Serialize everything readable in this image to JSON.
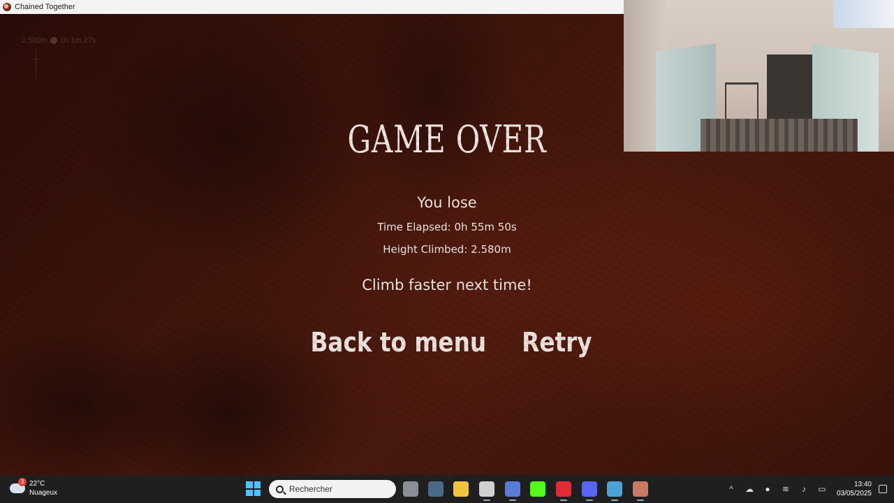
{
  "window": {
    "title": "Chained Together"
  },
  "hud": {
    "height": "2.580m",
    "time": "1h 1m 27s"
  },
  "game_over": {
    "title": "GAME OVER",
    "result": "You lose",
    "time_elapsed": "Time Elapsed: 0h 55m 50s",
    "height_climbed": "Height Climbed: 2.580m",
    "message": "Climb faster next time!",
    "buttons": {
      "back": "Back to menu",
      "retry": "Retry"
    }
  },
  "taskbar": {
    "weather": {
      "temp": "22°C",
      "condition": "Nuageux",
      "badge": "3"
    },
    "search_placeholder": "Rechercher",
    "apps": [
      {
        "name": "task-view-icon",
        "color": "#8a8f96"
      },
      {
        "name": "counter-strike-icon",
        "color": "#4b6a8a"
      },
      {
        "name": "file-explorer-icon",
        "color": "#f3c33d"
      },
      {
        "name": "chatgpt-icon",
        "color": "#d0d0d0"
      },
      {
        "name": "streaming-app-icon",
        "color": "#5a7bd8"
      },
      {
        "name": "kick-icon",
        "color": "#53fc18"
      },
      {
        "name": "opera-gx-icon",
        "color": "#e32b35"
      },
      {
        "name": "discord-icon",
        "color": "#5865f2"
      },
      {
        "name": "steam-icon",
        "color": "#4aa3d8"
      },
      {
        "name": "chained-together-icon",
        "color": "#c77a64"
      }
    ],
    "time": "13:40",
    "date": "03/05/2025"
  }
}
